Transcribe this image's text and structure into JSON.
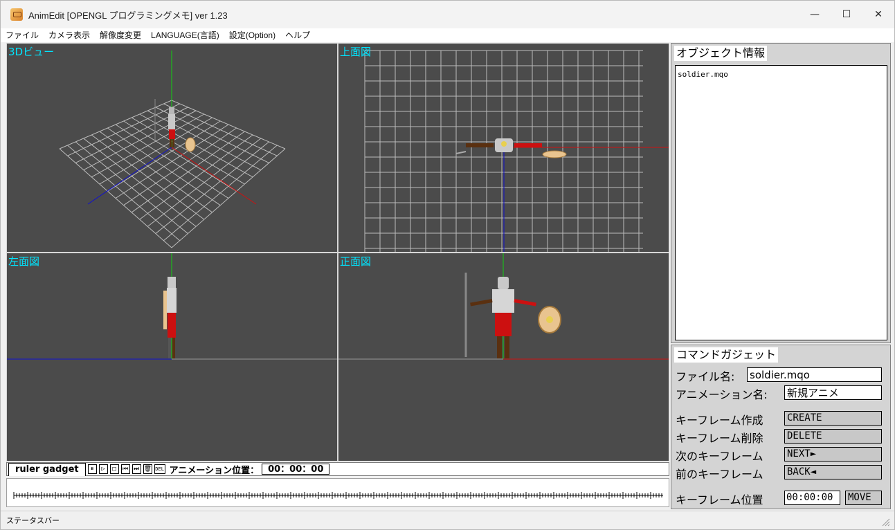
{
  "window": {
    "title": "AnimEdit [OPENGL プログラミングメモ] ver 1.23",
    "minimize": "—",
    "maximize": "☐",
    "close": "✕"
  },
  "menu": [
    "ファイル",
    "カメラ表示",
    "解像度変更",
    "LANGUAGE(言語)",
    "設定(Option)",
    "ヘルプ"
  ],
  "viewports": {
    "view3d": "3Dビュー",
    "top": "上面図",
    "left": "左面図",
    "front": "正面図"
  },
  "ruler": {
    "tab": "ruler gadget",
    "buttons": [
      "⏸",
      "▷",
      "□",
      "⏮",
      "⏭",
      "🗑",
      "DEL"
    ],
    "position_label": "アニメーション位置：",
    "position_value": "00：00：00"
  },
  "object_panel": {
    "tab": "オブジェクト情報",
    "items": [
      "soldier.mqo"
    ]
  },
  "command_panel": {
    "tab": "コマンドガジェット",
    "filename_label": "ファイル名:",
    "filename_value": "soldier.mqo",
    "anim_name_label": "アニメーション名:",
    "anim_name_value": "新規アニメ",
    "create_label": "キーフレーム作成",
    "create_btn": "CREATE",
    "delete_label": "キーフレーム削除",
    "delete_btn": "DELETE",
    "next_label": "次のキーフレーム",
    "next_btn": "NEXT►",
    "back_label": "前のキーフレーム",
    "back_btn": "BACK◄",
    "pos_label": "キーフレーム位置",
    "pos_value": "00:00:00",
    "move_btn": "MOVE"
  },
  "status": {
    "text": "ステータスバー"
  },
  "colors": {
    "viewport_bg": "#4b4b4b",
    "label_cyan": "#00e5ff",
    "axis_x": "#d01010",
    "axis_y": "#10d010",
    "axis_z": "#1010d0"
  }
}
